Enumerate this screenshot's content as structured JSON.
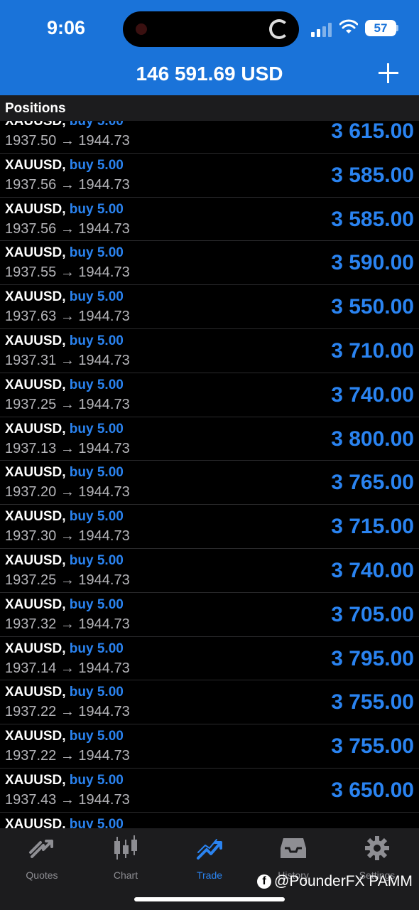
{
  "status_bar": {
    "time": "9:06",
    "battery": "57"
  },
  "header": {
    "balance": "146 591.69 USD",
    "add_icon": "plus-icon"
  },
  "section": {
    "title": "Positions"
  },
  "positions": [
    {
      "symbol": "XAUUSD,",
      "side": "buy 5.00",
      "prices": "1937.50 → 1944.73",
      "profit": "3 615.00"
    },
    {
      "symbol": "XAUUSD,",
      "side": "buy 5.00",
      "prices": "1937.56 → 1944.73",
      "profit": "3 585.00"
    },
    {
      "symbol": "XAUUSD,",
      "side": "buy 5.00",
      "prices": "1937.56 → 1944.73",
      "profit": "3 585.00"
    },
    {
      "symbol": "XAUUSD,",
      "side": "buy 5.00",
      "prices": "1937.55 → 1944.73",
      "profit": "3 590.00"
    },
    {
      "symbol": "XAUUSD,",
      "side": "buy 5.00",
      "prices": "1937.63 → 1944.73",
      "profit": "3 550.00"
    },
    {
      "symbol": "XAUUSD,",
      "side": "buy 5.00",
      "prices": "1937.31 → 1944.73",
      "profit": "3 710.00"
    },
    {
      "symbol": "XAUUSD,",
      "side": "buy 5.00",
      "prices": "1937.25 → 1944.73",
      "profit": "3 740.00"
    },
    {
      "symbol": "XAUUSD,",
      "side": "buy 5.00",
      "prices": "1937.13 → 1944.73",
      "profit": "3 800.00"
    },
    {
      "symbol": "XAUUSD,",
      "side": "buy 5.00",
      "prices": "1937.20 → 1944.73",
      "profit": "3 765.00"
    },
    {
      "symbol": "XAUUSD,",
      "side": "buy 5.00",
      "prices": "1937.30 → 1944.73",
      "profit": "3 715.00"
    },
    {
      "symbol": "XAUUSD,",
      "side": "buy 5.00",
      "prices": "1937.25 → 1944.73",
      "profit": "3 740.00"
    },
    {
      "symbol": "XAUUSD,",
      "side": "buy 5.00",
      "prices": "1937.32 → 1944.73",
      "profit": "3 705.00"
    },
    {
      "symbol": "XAUUSD,",
      "side": "buy 5.00",
      "prices": "1937.14 → 1944.73",
      "profit": "3 795.00"
    },
    {
      "symbol": "XAUUSD,",
      "side": "buy 5.00",
      "prices": "1937.22 → 1944.73",
      "profit": "3 755.00"
    },
    {
      "symbol": "XAUUSD,",
      "side": "buy 5.00",
      "prices": "1937.22 → 1944.73",
      "profit": "3 755.00"
    },
    {
      "symbol": "XAUUSD,",
      "side": "buy 5.00",
      "prices": "1937.43 → 1944.73",
      "profit": "3 650.00"
    },
    {
      "symbol": "XAUUSD,",
      "side": "buy 5.00",
      "prices": "",
      "profit": ""
    }
  ],
  "tabs": [
    {
      "label": "Quotes",
      "icon": "quotes-icon",
      "active": false
    },
    {
      "label": "Chart",
      "icon": "chart-candles-icon",
      "active": false
    },
    {
      "label": "Trade",
      "icon": "trade-icon",
      "active": true
    },
    {
      "label": "History",
      "icon": "history-icon",
      "active": false
    },
    {
      "label": "Settings",
      "icon": "gear-icon",
      "active": false
    }
  ],
  "watermark": {
    "text": "@PounderFX PAMM"
  },
  "colors": {
    "header_bg": "#1a73d9",
    "accent_blue": "#2a83f0",
    "list_bg": "#000000"
  }
}
